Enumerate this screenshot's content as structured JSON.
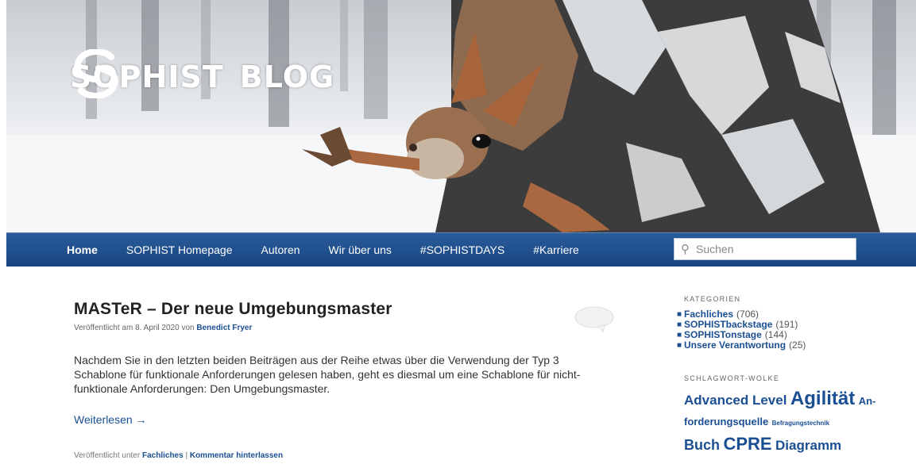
{
  "header": {
    "logo_left": "SOPHIST",
    "logo_right": "BLOG"
  },
  "nav": {
    "items": [
      {
        "label": "Home"
      },
      {
        "label": "SOPHIST Homepage"
      },
      {
        "label": "Autoren"
      },
      {
        "label": "Wir über uns"
      },
      {
        "label": "#SOPHISTDAYS"
      },
      {
        "label": "#Karriere"
      }
    ],
    "search_placeholder": "Suchen"
  },
  "post": {
    "title": "MASTeR – Der neue Umgebungsmaster",
    "meta_prefix": "Veröffentlicht am 8. April 2020 von ",
    "author": "Benedict Fryer",
    "excerpt": "Nachdem Sie in den letzten beiden Beiträgen aus der Reihe etwas über die Verwendung der Typ 3 Schablone für funktionale Anforderungen gelesen haben, geht es diesmal um eine Schablone für nicht-funktionale Anforderungen: Den Umgebungsmaster.",
    "read_more": "Weiterlesen →",
    "footer_prefix": "Veröffentlicht unter ",
    "footer_category": "Fachliches",
    "footer_separator": " | ",
    "footer_comment": "Kommentar hinterlassen"
  },
  "sidebar": {
    "categories_title": "KATEGORIEN",
    "categories": [
      {
        "name": "Fachliches",
        "count": "(706)"
      },
      {
        "name": "SOPHISTbackstage",
        "count": "(191)"
      },
      {
        "name": "SOPHISTonstage",
        "count": "(144)"
      },
      {
        "name": "Unsere Verantwortung",
        "count": "(25)"
      }
    ],
    "tagcloud_title": "SCHLAGWORT-WOLKE",
    "tags": [
      {
        "label": "Advanced Level"
      },
      {
        "label": "Agilität"
      },
      {
        "label": "An-"
      },
      {
        "label": "forderungsquelle"
      },
      {
        "label": "Befragungstechnik"
      },
      {
        "label": "Buch"
      },
      {
        "label": "CPRE"
      },
      {
        "label": "Diagramm"
      }
    ]
  },
  "colors": {
    "nav_blue": "#1f4f8c",
    "link_blue": "#1b4f93"
  }
}
